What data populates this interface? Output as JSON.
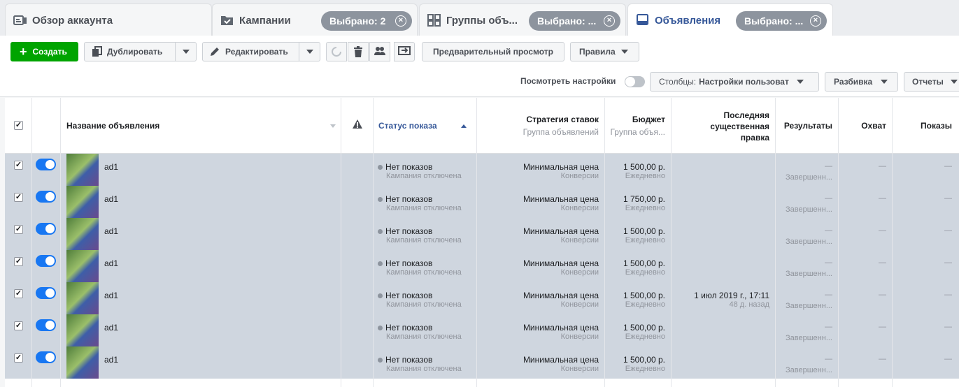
{
  "tabs": [
    {
      "label": "Обзор аккаунта"
    },
    {
      "label": "Кампании",
      "pill": "Выбрано: 2"
    },
    {
      "label": "Группы объ...",
      "pill": "Выбрано: ..."
    },
    {
      "label": "Объявления",
      "pill": "Выбрано: ..."
    }
  ],
  "toolbar": {
    "create": "Создать",
    "duplicate": "Дублировать",
    "edit": "Редактировать",
    "preview": "Предварительный просмотр",
    "rules": "Правила",
    "view_settings": "Посмотреть настройки",
    "columns_prefix": "Столбцы:",
    "columns_value": "Настройки пользоват",
    "breakdown": "Разбивка",
    "reports": "Отчеты"
  },
  "columns": {
    "name": "Название объявления",
    "status": "Статус показа",
    "bid": "Стратегия ставок",
    "bid_sub": "Группа объявлений",
    "budget": "Бюджет",
    "budget_sub": "Группа объя...",
    "last_edit": "Последняя существенная правка",
    "results": "Результаты",
    "reach": "Охват",
    "impressions": "Показы"
  },
  "rows": [
    {
      "name": "ad1",
      "status": "Нет показов",
      "status_sub": "Кампания отключена",
      "bid": "Минимальная цена",
      "bid_sub": "Конверсии",
      "budget": "1 500,00 р.",
      "budget_sub": "Ежедневно",
      "edit": "",
      "edit_sub": "",
      "results": "—",
      "results_sub": "Завершенн...",
      "reach": "—",
      "impressions": "—"
    },
    {
      "name": "ad1",
      "status": "Нет показов",
      "status_sub": "Кампания отключена",
      "bid": "Минимальная цена",
      "bid_sub": "Конверсии",
      "budget": "1 750,00 р.",
      "budget_sub": "Ежедневно",
      "edit": "",
      "edit_sub": "",
      "results": "—",
      "results_sub": "Завершенн...",
      "reach": "—",
      "impressions": "—"
    },
    {
      "name": "ad1",
      "status": "Нет показов",
      "status_sub": "Кампания отключена",
      "bid": "Минимальная цена",
      "bid_sub": "Конверсии",
      "budget": "1 500,00 р.",
      "budget_sub": "Ежедневно",
      "edit": "",
      "edit_sub": "",
      "results": "—",
      "results_sub": "Завершенн...",
      "reach": "—",
      "impressions": "—"
    },
    {
      "name": "ad1",
      "status": "Нет показов",
      "status_sub": "Кампания отключена",
      "bid": "Минимальная цена",
      "bid_sub": "Конверсии",
      "budget": "1 500,00 р.",
      "budget_sub": "Ежедневно",
      "edit": "",
      "edit_sub": "",
      "results": "—",
      "results_sub": "Завершенн...",
      "reach": "—",
      "impressions": "—"
    },
    {
      "name": "ad1",
      "status": "Нет показов",
      "status_sub": "Кампания отключена",
      "bid": "Минимальная цена",
      "bid_sub": "Конверсии",
      "budget": "1 500,00 р.",
      "budget_sub": "Ежедневно",
      "edit": "1 июл 2019 г., 17:11",
      "edit_sub": "48 д. назад",
      "results": "—",
      "results_sub": "Завершенн...",
      "reach": "—",
      "impressions": "—"
    },
    {
      "name": "ad1",
      "status": "Нет показов",
      "status_sub": "Кампания отключена",
      "bid": "Минимальная цена",
      "bid_sub": "Конверсии",
      "budget": "1 500,00 р.",
      "budget_sub": "Ежедневно",
      "edit": "",
      "edit_sub": "",
      "results": "—",
      "results_sub": "Завершенн...",
      "reach": "—",
      "impressions": "—"
    },
    {
      "name": "ad1",
      "status": "Нет показов",
      "status_sub": "Кампания отключена",
      "bid": "Минимальная цена",
      "bid_sub": "Конверсии",
      "budget": "1 500,00 р.",
      "budget_sub": "Ежедневно",
      "edit": "",
      "edit_sub": "",
      "results": "—",
      "results_sub": "Завершенн...",
      "reach": "—",
      "impressions": "—"
    }
  ],
  "colors": {
    "accent": "#365899",
    "create": "#00a400",
    "toggle_on": "#1877f2",
    "selected_row": "#cfd6df"
  }
}
